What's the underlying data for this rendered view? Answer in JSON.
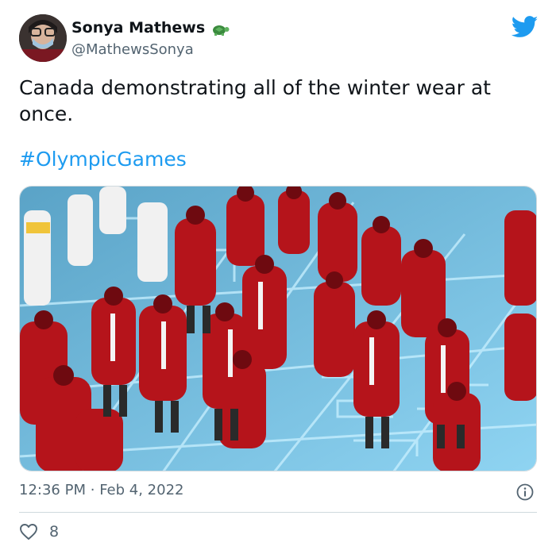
{
  "author": {
    "name": "Sonya Mathews",
    "handle": "@MathewsSonya",
    "name_emoji_icon": "turtle-icon"
  },
  "tweet": {
    "text": "Canada demonstrating all of the winter wear at once.",
    "hashtag": "#OlympicGames"
  },
  "meta": {
    "time": "12:36 PM",
    "separator": "·",
    "date": "Feb 4, 2022"
  },
  "engagement": {
    "like_icon": "heart-icon",
    "likes": "8"
  },
  "colors": {
    "brand_blue": "#1d9bf0",
    "text_primary": "#0f1419",
    "text_secondary": "#536471",
    "divider": "#cfd9de",
    "jacket_red": "#b5141b",
    "rink_blue": "#7fc8f0"
  }
}
